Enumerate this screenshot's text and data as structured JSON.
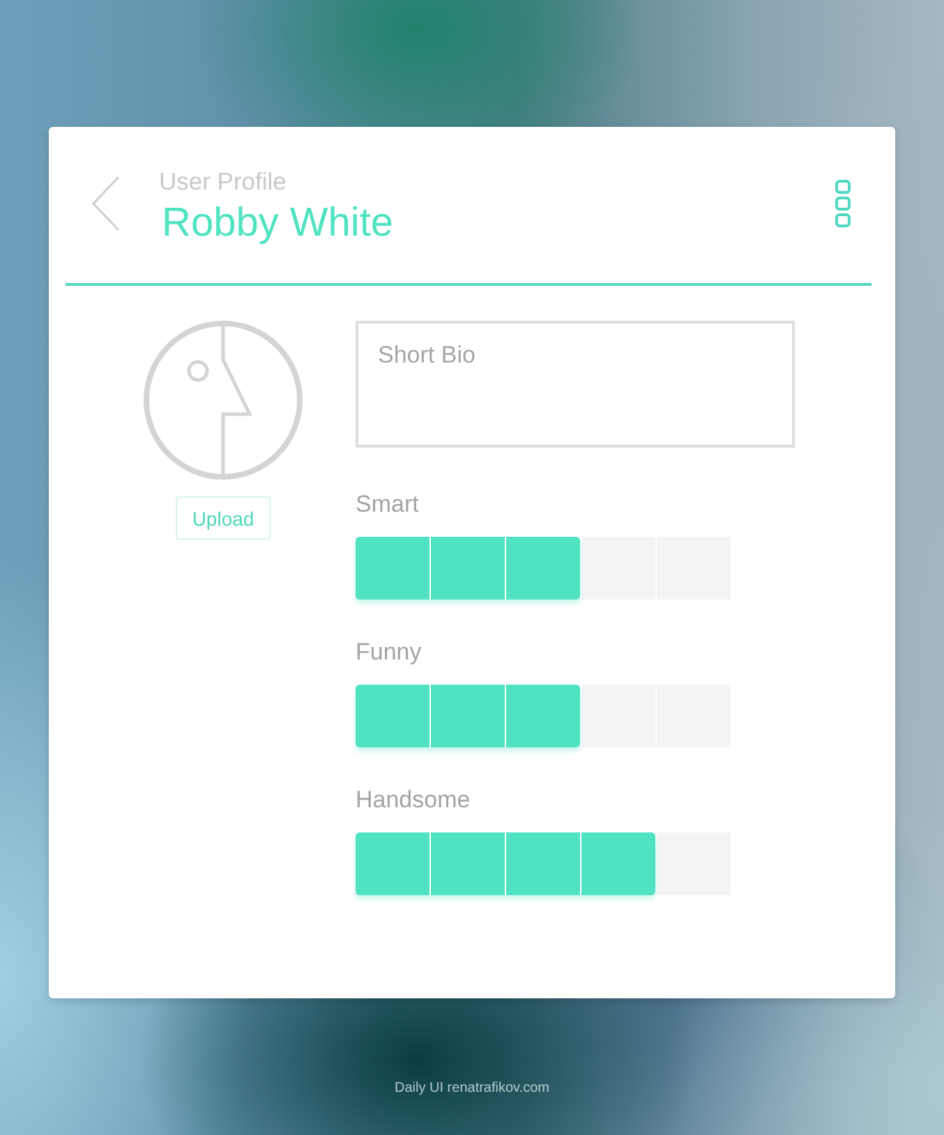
{
  "header": {
    "subtitle": "User Profile",
    "title": "Robby White"
  },
  "avatar": {
    "upload_button": "Upload"
  },
  "bio": {
    "placeholder": "Short Bio"
  },
  "ratings": [
    {
      "label": "Smart",
      "level": 0.6
    },
    {
      "label": "Funny",
      "level": 0.6
    },
    {
      "label": "Handsome",
      "level": 0.8
    }
  ],
  "footer": "Daily UI renatrafikov.com"
}
